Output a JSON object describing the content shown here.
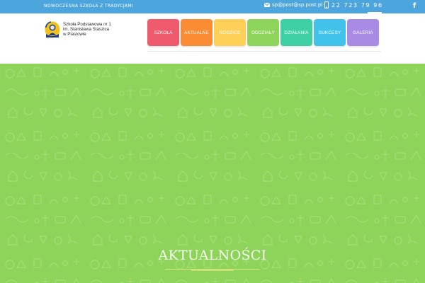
{
  "topbar": {
    "tagline": "NOWOCZESNA SZKOŁA Z TRADYCJAMI",
    "email": "sp@post@sp.post.pl",
    "phone": "22 723 79 96",
    "facebook_icon": "facebook-icon"
  },
  "header": {
    "school_name_lines": [
      "Szkoła Podstawowa nr 1",
      "im. Stanisława Staszica",
      "w Piastowie"
    ],
    "logo_icon": "school-logo-icon"
  },
  "nav": {
    "items": [
      {
        "label": "SZKOŁA",
        "color": "#ef5a6d"
      },
      {
        "label": "AKTUALNE",
        "color": "#fb8c33"
      },
      {
        "label": "RODZICE",
        "color": "#ffd057"
      },
      {
        "label": "ODDZIAŁY",
        "color": "#8dd45a"
      },
      {
        "label": "DZIAŁANIA",
        "color": "#3ecfa5"
      },
      {
        "label": "SUKCESY",
        "color": "#41c2ea"
      },
      {
        "label": "GALERIA",
        "color": "#a98be6"
      }
    ]
  },
  "hero": {
    "title": "AKTUALNOŚCI",
    "background": "#8fd45a"
  },
  "colors": {
    "topbar": "#4da5dd"
  }
}
